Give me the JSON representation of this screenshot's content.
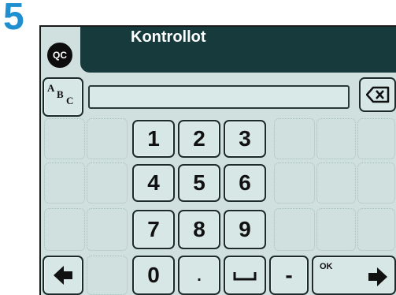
{
  "step_number": "5",
  "header": {
    "title": "Kontrollot",
    "logo_text": "QC"
  },
  "keyboard": {
    "mode_key": {
      "upper_a": "A",
      "upper_b": "B",
      "upper_c": "C"
    },
    "input_value": "",
    "digits": [
      "1",
      "2",
      "3",
      "4",
      "5",
      "6",
      "7",
      "8",
      "9",
      "0"
    ],
    "dot": ".",
    "space": "",
    "minus": "-",
    "ok": "OK"
  },
  "icons": {
    "backspace": "backspace-icon",
    "left": "arrow-left-icon",
    "right": "arrow-right-icon"
  },
  "colors": {
    "accent": "#1f8fd0",
    "header": "#173b3c",
    "screen": "#cfe0de"
  }
}
